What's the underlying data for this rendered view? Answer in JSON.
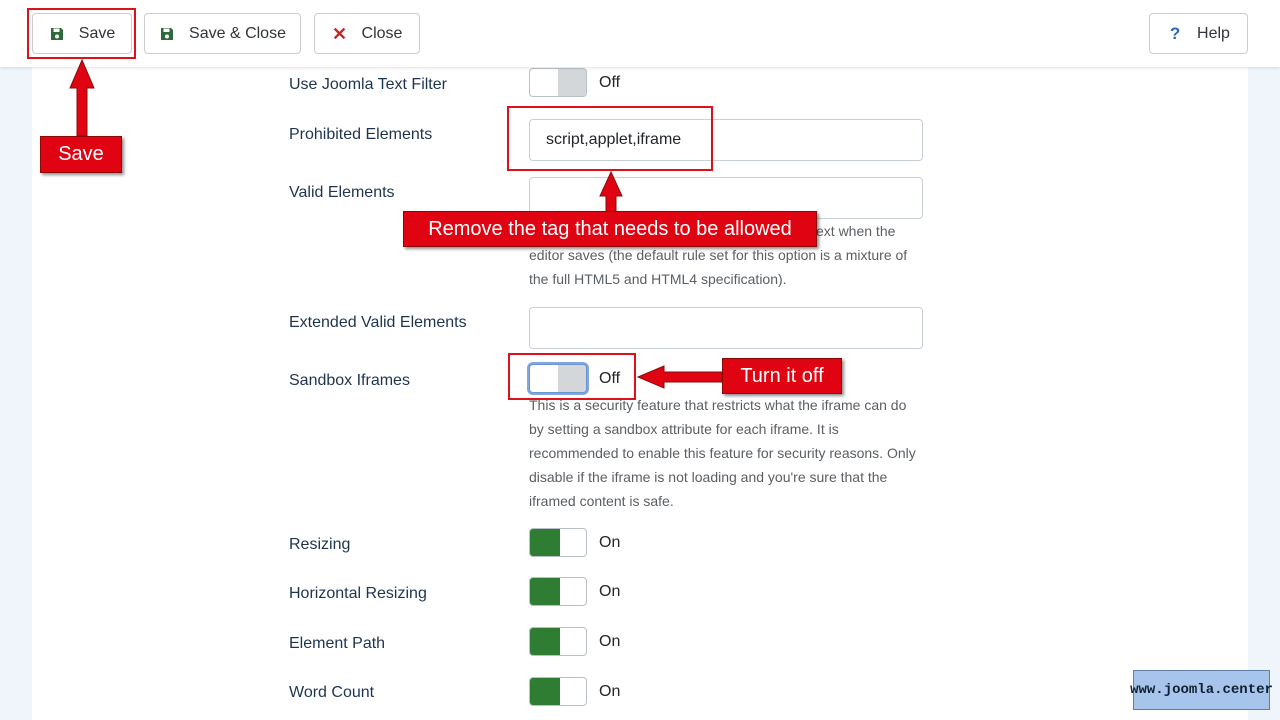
{
  "toolbar": {
    "save_label": "Save",
    "save_close_label": "Save & Close",
    "close_label": "Close",
    "help_label": "Help"
  },
  "settings": {
    "text_filter": {
      "label": "Use Joomla Text Filter",
      "state": "Off"
    },
    "prohibited": {
      "label": "Prohibited Elements",
      "value": "script,applet,iframe"
    },
    "valid": {
      "label": "Valid Elements",
      "value": "",
      "desc_line1": "ext when the",
      "desc_line2": "editor saves (the default rule set for this option is a mixture of",
      "desc_line3": "the full HTML5 and HTML4 specification)."
    },
    "extended_valid": {
      "label": "Extended Valid Elements",
      "value": ""
    },
    "sandbox": {
      "label": "Sandbox Iframes",
      "state": "Off",
      "desc_lines": [
        "This is a security feature that restricts what the iframe can do",
        "by setting a sandbox attribute for each iframe. It is",
        "recommended to enable this feature for security reasons. Only",
        "disable if the iframe is not loading and you're sure that the",
        "iframed content is safe."
      ]
    },
    "resizing": {
      "label": "Resizing",
      "state": "On"
    },
    "horizontal_resizing": {
      "label": "Horizontal Resizing",
      "state": "On"
    },
    "element_path": {
      "label": "Element Path",
      "state": "On"
    },
    "word_count": {
      "label": "Word Count",
      "state": "On"
    }
  },
  "annotations": {
    "save": "Save",
    "remove_tag": "Remove the tag that needs to be allowed",
    "turn_off": "Turn it off",
    "color": "#e00412"
  },
  "watermark": "www.joomla.center",
  "colors": {
    "on_green": "#2e7d32",
    "label_blue": "#1e3450",
    "close_red": "#c52827"
  }
}
